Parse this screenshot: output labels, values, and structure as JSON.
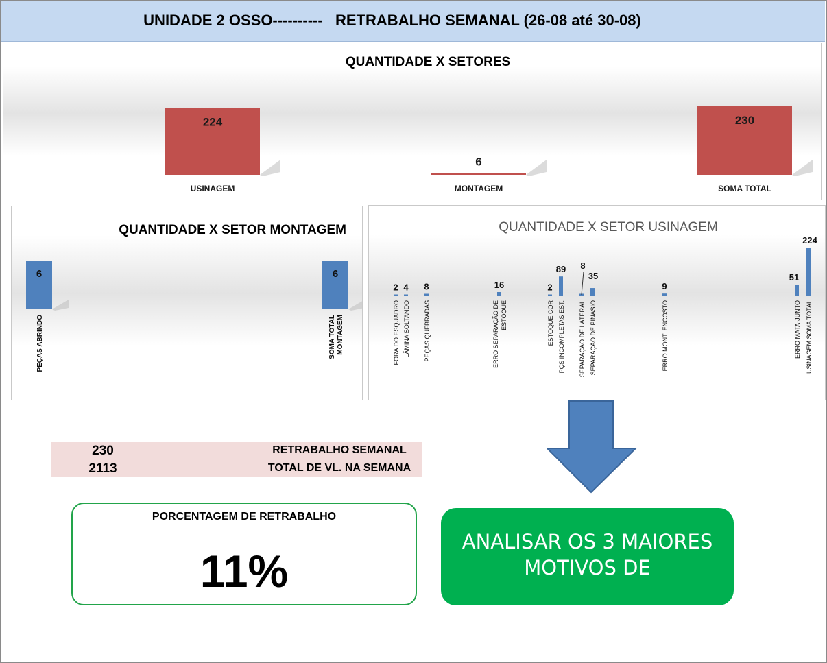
{
  "header": {
    "title": "UNIDADE 2 OSSO----------   RETRABALHO SEMANAL (26-08 até 30-08)"
  },
  "chart_data": [
    {
      "type": "bar",
      "title": "QUANTIDADE X SETORES",
      "categories": [
        "USINAGEM",
        "MONTAGEM",
        "SOMA TOTAL"
      ],
      "values": [
        224,
        6,
        230
      ],
      "color": "#c0504d"
    },
    {
      "type": "bar",
      "title": "QUANTIDADE X SETOR MONTAGEM",
      "categories": [
        "PEÇAS ABRINDO",
        "SOMA TOTAL MONTAGEM"
      ],
      "category_lines": [
        [
          "PEÇAS ABRINDO"
        ],
        [
          "SOMA TOTAL",
          "MONTAGEM"
        ]
      ],
      "values": [
        6,
        6
      ],
      "color": "#4f81bd"
    },
    {
      "type": "bar",
      "title": "QUANTIDADE X SETOR USINAGEM",
      "categories": [
        "FORA DO ESQUADRO",
        "LÂMINA SOLTANDO",
        "PEÇAS QUEBRADAS",
        "ERRO SEPARAÇÃO DE ESTOQUE",
        "ESTOQUE COR",
        "PÇS INCOMPLETAS EST.",
        "SEPARAÇÃO DE LATERAL",
        "SEPARAÇÃO DE PINASIO",
        "ERRO MONT. ENCOSTO",
        "ERRO MATA-JUNTO",
        "USINAGEM SOMA TOTAL"
      ],
      "category_lines": [
        [
          "FORA DO ESQUADRO"
        ],
        [
          "LÂMINA SOLTANDO"
        ],
        [
          "PEÇAS QUEBRADAS"
        ],
        [
          "ERRO SEPARAÇÃO DE",
          "ESTOQUE"
        ],
        [
          "ESTOQUE COR"
        ],
        [
          "PÇS INCOMPLETAS EST."
        ],
        [
          "SEPARAÇÃO DE LATERAL"
        ],
        [
          "SEPARAÇÃO DE PINASIO"
        ],
        [
          "ERRO MONT. ENCOSTO"
        ],
        [
          "ERRO MATA-JUNTO"
        ],
        [
          "USINAGEM SOMA TOTAL"
        ]
      ],
      "values": [
        2,
        4,
        8,
        16,
        2,
        89,
        8,
        35,
        9,
        51,
        224
      ],
      "color": "#4f81bd"
    }
  ],
  "summary": {
    "rows": [
      {
        "value": "230",
        "label": "RETRABALHO SEMANAL"
      },
      {
        "value": "2113",
        "label": "TOTAL DE VL. NA SEMANA"
      }
    ]
  },
  "percentage": {
    "label": "PORCENTAGEM DE RETRABALHO",
    "value": "11%"
  },
  "callout": {
    "line1": "ANALISAR OS 3 MAIORES",
    "line2": "MOTIVOS DE"
  },
  "colors": {
    "header_bg": "#c5d9f1",
    "red_bar": "#c0504d",
    "blue_bar": "#4f81bd",
    "green": "#00b050",
    "summary_bg": "#f2dcdb"
  }
}
